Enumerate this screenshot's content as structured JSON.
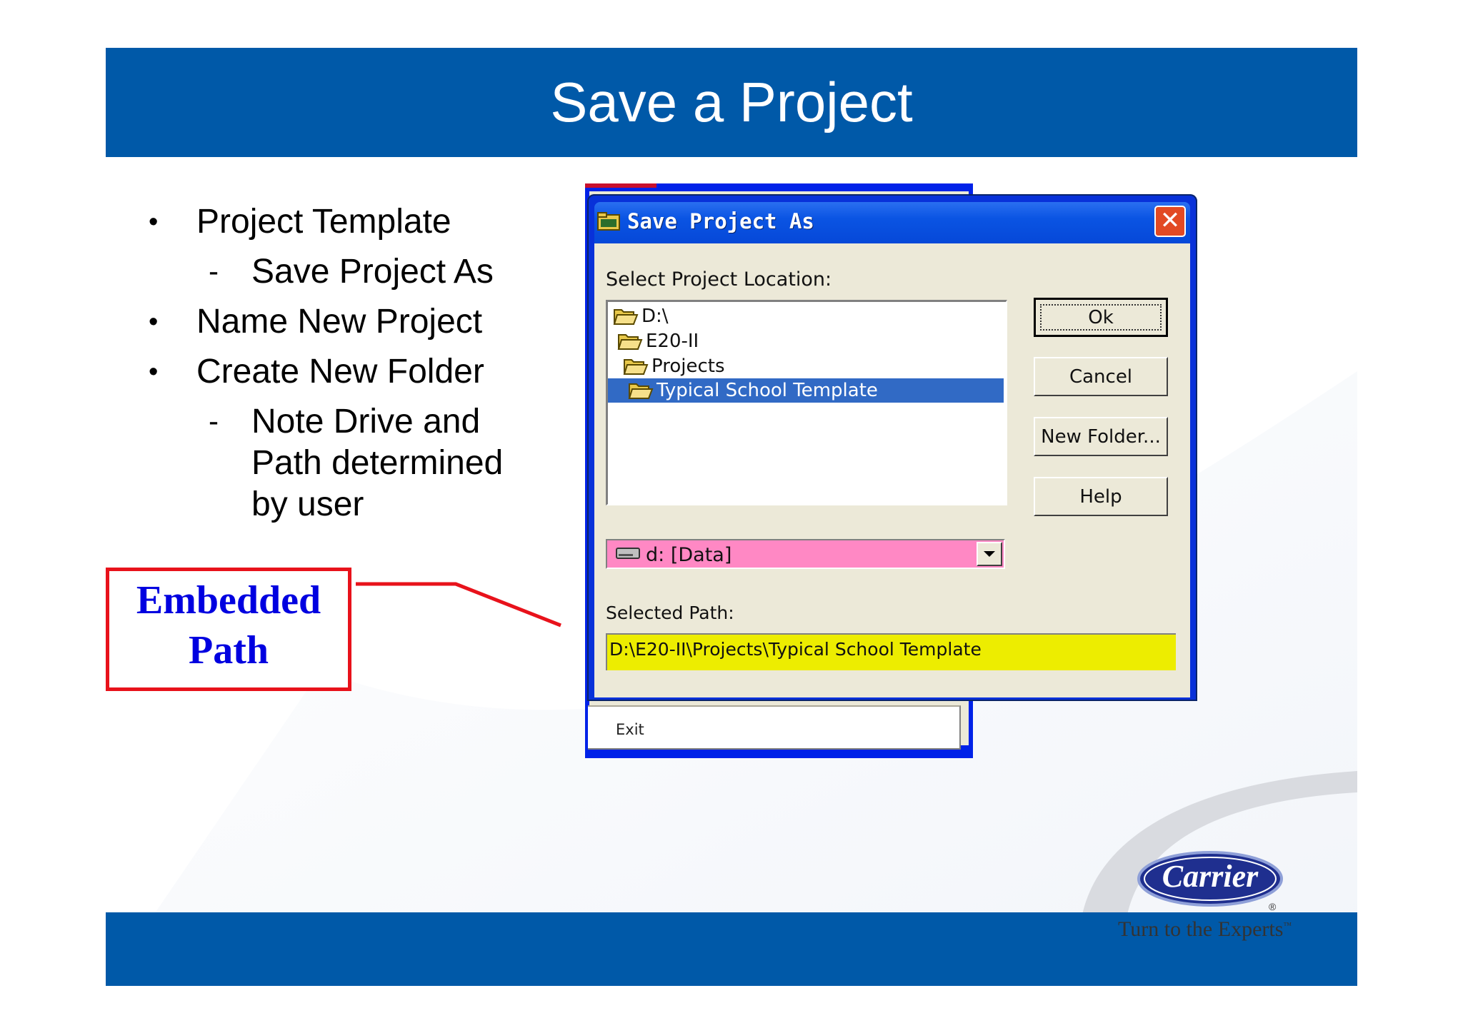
{
  "slide": {
    "title": "Save a Project",
    "bullets": [
      {
        "level": 1,
        "text": "Project Template"
      },
      {
        "level": 2,
        "text": "Save Project As"
      },
      {
        "level": 1,
        "text": "Name New Project"
      },
      {
        "level": 1,
        "text": "Create New Folder"
      },
      {
        "level": 2,
        "lines": [
          "Note Drive and",
          "Path determined",
          "by user"
        ]
      }
    ],
    "bullet_glyph": "•",
    "dash_glyph": "-",
    "callout": {
      "line1": "Embedded",
      "line2": "Path",
      "border_color": "#e8121b",
      "text_color": "#0000e0"
    }
  },
  "background_window": {
    "menu_item": "Exit"
  },
  "dialog": {
    "title": "Save Project As",
    "title_icon": "folder-icon",
    "close_glyph": "✕",
    "location_label": "Select Project Location:",
    "tree": [
      {
        "label": "D:\\",
        "icon": "open-folder-icon",
        "selected": false
      },
      {
        "label": "E20-II",
        "icon": "open-folder-icon",
        "selected": false
      },
      {
        "label": "Projects",
        "icon": "open-folder-icon",
        "selected": false
      },
      {
        "label": "Typical School Template",
        "icon": "open-folder-icon",
        "selected": true
      }
    ],
    "buttons": {
      "ok": "Ok",
      "cancel": "Cancel",
      "new_folder": "New Folder...",
      "help": "Help"
    },
    "drive": {
      "value": "d: [Data]",
      "icon": "drive-icon",
      "highlight": "#ff88c4"
    },
    "path_label": "Selected Path:",
    "path_value": "D:\\E20-II\\Projects\\Typical School Template",
    "path_highlight": "#eded00"
  },
  "logo": {
    "name": "Carrier",
    "registered": "®",
    "tagline": "Turn to the Experts",
    "tagline_mark": "™"
  },
  "colors": {
    "brand_blue": "#0059a8",
    "xp_title": "#0a54e3",
    "selection": "#316ac5"
  }
}
